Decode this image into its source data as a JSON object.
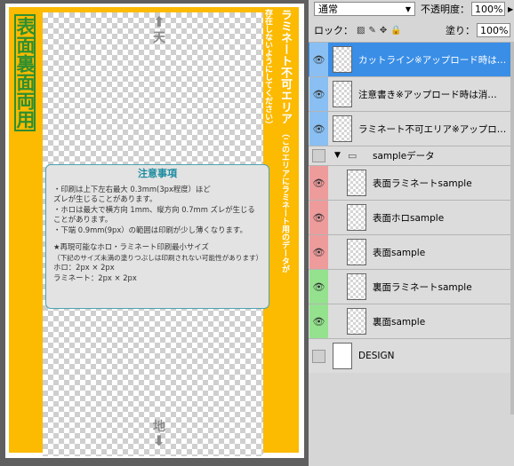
{
  "canvas": {
    "side_label": "表面裏面両用",
    "laminate_title": "ラミネート不可エリア",
    "laminate_sub": "（このエリアにラミネート用のデータが存在しないようにしてください）",
    "top_arrow_label": "天",
    "bottom_arrow_label": "地",
    "notes": {
      "title": "注意事項",
      "lines": [
        "・印刷は上下左右最大 0.3mm(3px程度）ほど",
        "ズレが生じることがあります。",
        "・ホロは最大で横方向 1mm、縦方向 0.7mm ズレが生じる",
        "ことがあります。",
        "・下端 0.9mm(9px）の範囲は印刷が少し薄くなります。",
        "★再現可能なホロ・ラミネート印刷最小サイズ",
        "（下記のサイズ未満の塗りつぶしは印刷されない可能性があります）",
        "ホロ：2px × 2px",
        "ラミネート：2px × 2px"
      ]
    }
  },
  "panel": {
    "blend_mode": "通常",
    "opacity_label": "不透明度：",
    "opacity_value": "100%",
    "lock_label": "ロック：",
    "fill_label": "塗り：",
    "fill_value": "100%",
    "layers": [
      {
        "name": "カットライン※アップロード時は…",
        "color": "blue",
        "selected": true
      },
      {
        "name": "注意書き※アップロード時は消…",
        "color": "blue",
        "selected": false
      },
      {
        "name": "ラミネート不可エリア※アップロ…",
        "color": "blue",
        "selected": false
      },
      {
        "name": "sampleデータ",
        "color": "none",
        "group": true
      },
      {
        "name": "表面ラミネートsample",
        "color": "red"
      },
      {
        "name": "表面ホロsample",
        "color": "red"
      },
      {
        "name": "表面sample",
        "color": "red"
      },
      {
        "name": "裏面ラミネートsample",
        "color": "green"
      },
      {
        "name": "裏面sample",
        "color": "green"
      },
      {
        "name": "DESIGN",
        "color": "none"
      }
    ]
  }
}
